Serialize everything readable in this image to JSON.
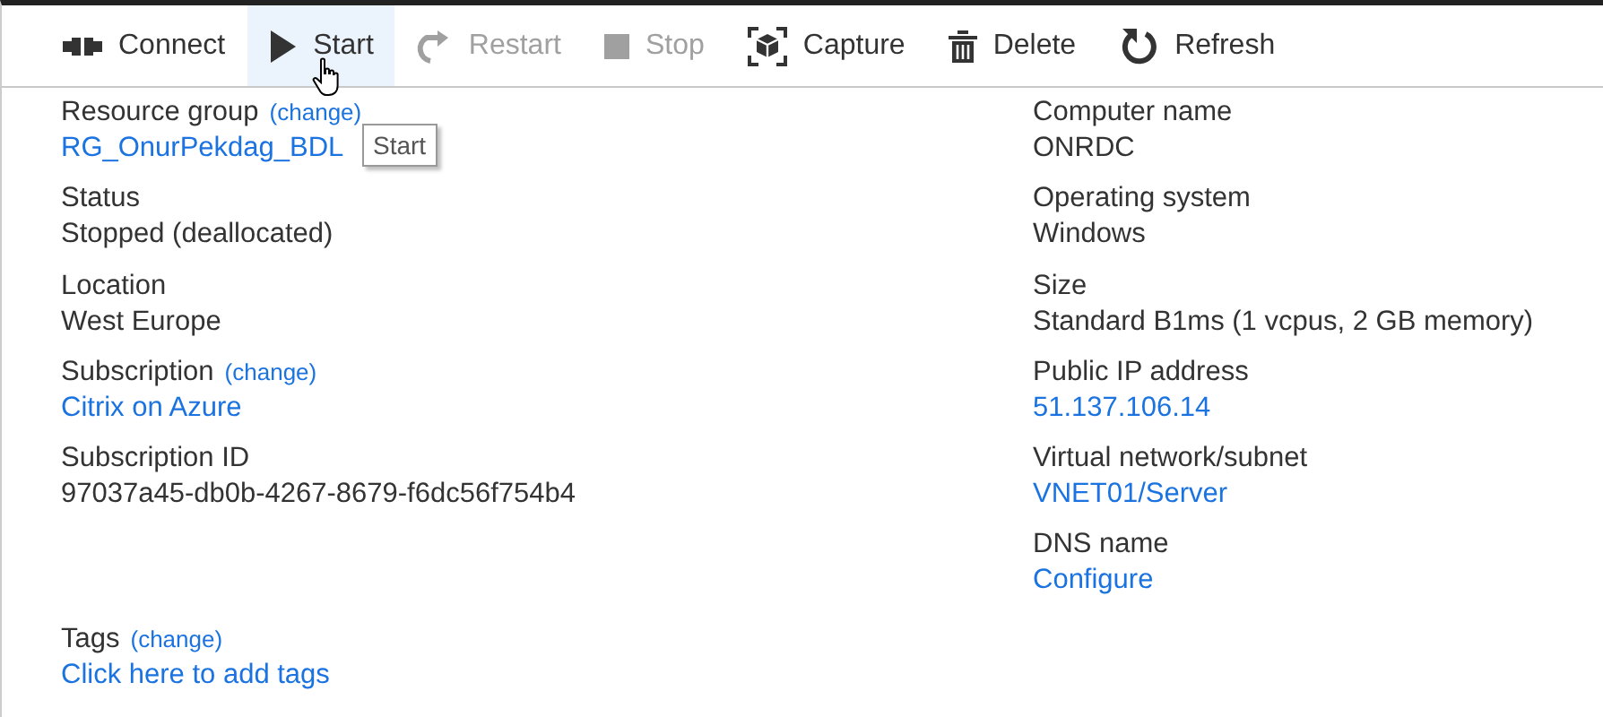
{
  "toolbar": [
    {
      "kind": "connect",
      "label": "Connect",
      "disabled": false,
      "hovered": false
    },
    {
      "kind": "start",
      "label": "Start",
      "disabled": false,
      "hovered": true
    },
    {
      "kind": "restart",
      "label": "Restart",
      "disabled": true,
      "hovered": false
    },
    {
      "kind": "stop",
      "label": "Stop",
      "disabled": true,
      "hovered": false
    },
    {
      "kind": "capture",
      "label": "Capture",
      "disabled": false,
      "hovered": false
    },
    {
      "kind": "delete",
      "label": "Delete",
      "disabled": false,
      "hovered": false
    },
    {
      "kind": "refresh",
      "label": "Refresh",
      "disabled": false,
      "hovered": false
    }
  ],
  "tooltip": "Start",
  "left": [
    {
      "label": "Resource group",
      "change": "(change)",
      "value": "RG_OnurPekdag_BDL",
      "kind": "link"
    },
    {
      "label": "Status",
      "value": "Stopped (deallocated)",
      "kind": "text"
    },
    {
      "label": "Location",
      "value": "West Europe",
      "kind": "text"
    },
    {
      "label": "Subscription",
      "change": "(change)",
      "value": "Citrix on Azure",
      "kind": "link"
    },
    {
      "label": "Subscription ID",
      "value": "97037a45-db0b-4267-8679-f6dc56f754b4",
      "kind": "text"
    }
  ],
  "right": [
    {
      "label": "Computer name",
      "value": "ONRDC",
      "kind": "text"
    },
    {
      "label": "Operating system",
      "value": "Windows",
      "kind": "text"
    },
    {
      "label": "Size",
      "value": "Standard B1ms (1 vcpus, 2 GB memory)",
      "kind": "text"
    },
    {
      "label": "Public IP address",
      "value": "51.137.106.14",
      "kind": "link"
    },
    {
      "label": "Virtual network/subnet",
      "value": "VNET01/Server",
      "kind": "link"
    },
    {
      "label": "DNS name",
      "value": "Configure",
      "kind": "link"
    }
  ],
  "tags": {
    "label": "Tags",
    "change": "(change)",
    "value": "Click here to add tags",
    "kind": "link"
  }
}
